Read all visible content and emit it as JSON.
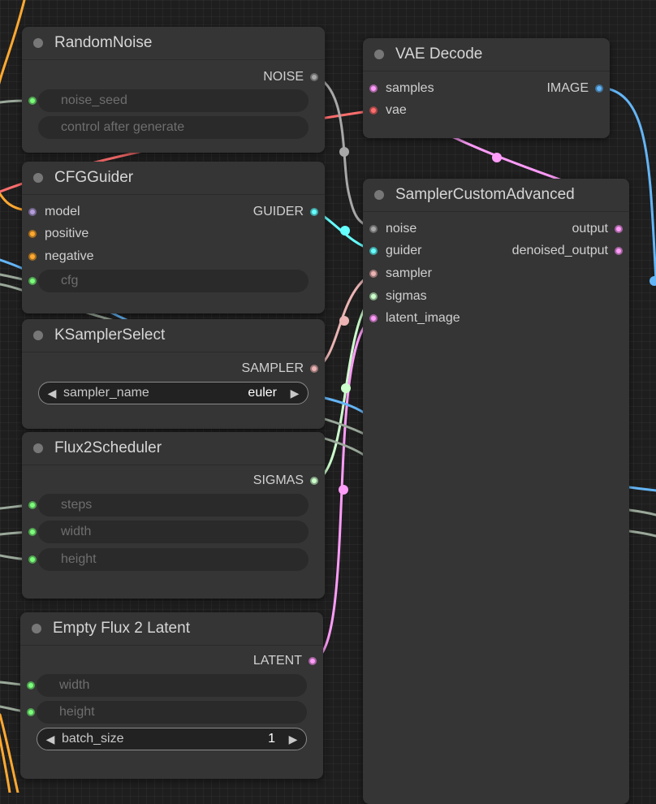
{
  "colors": {
    "noise": "#a8a8a8",
    "model": "#b39ddb",
    "conditioning": "#ffa931",
    "float": "#8fff8f",
    "guider": "#66ffff",
    "sampler": "#ecb4b4",
    "sigmas": "#cdffcd",
    "latent": "#ff9cf9",
    "image": "#64b5f6",
    "vae": "#ff6e6e",
    "int": "#7cfc7c"
  },
  "nodes": {
    "random_noise": {
      "title": "RandomNoise",
      "output": "NOISE",
      "widgets": {
        "noise_seed": "noise_seed",
        "control": "control after generate"
      }
    },
    "cfg_guider": {
      "title": "CFGGuider",
      "inputs": [
        "model",
        "positive",
        "negative"
      ],
      "output": "GUIDER",
      "widgets": {
        "cfg": "cfg"
      }
    },
    "ksampler_select": {
      "title": "KSamplerSelect",
      "output": "SAMPLER",
      "combo_label": "sampler_name",
      "combo_value": "euler"
    },
    "flux2_scheduler": {
      "title": "Flux2Scheduler",
      "output": "SIGMAS",
      "widgets": [
        "steps",
        "width",
        "height"
      ]
    },
    "empty_latent": {
      "title": "Empty Flux 2 Latent",
      "output": "LATENT",
      "widgets": [
        "width",
        "height"
      ],
      "combo_label": "batch_size",
      "combo_value": "1"
    },
    "vae_decode": {
      "title": "VAE Decode",
      "inputs": [
        "samples",
        "vae"
      ],
      "output": "IMAGE"
    },
    "sampler_custom_advanced": {
      "title": "SamplerCustomAdvanced",
      "inputs": [
        "noise",
        "guider",
        "sampler",
        "sigmas",
        "latent_image"
      ],
      "outputs": [
        "output",
        "denoised_output"
      ]
    }
  },
  "icons": {
    "combo_left": "◀",
    "combo_right": "▶"
  }
}
